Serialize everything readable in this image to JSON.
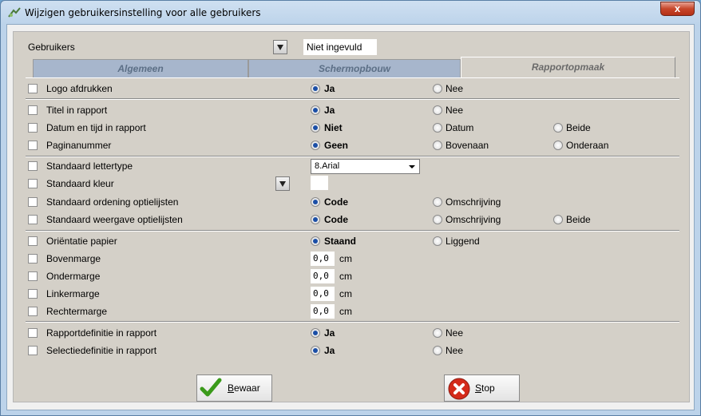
{
  "window": {
    "title": "Wijzigen gebruikersinstelling voor alle gebruikers",
    "close_label": "x"
  },
  "users": {
    "label": "Gebruikers",
    "value": "Niet ingevuld"
  },
  "tabs": [
    {
      "label": "Algemeen"
    },
    {
      "label": "Schermopbouw"
    },
    {
      "label": "Rapportopmaak"
    }
  ],
  "rows": {
    "logo": {
      "label": "Logo afdrukken",
      "opt1": "Ja",
      "opt2": "Nee"
    },
    "titel": {
      "label": "Titel in rapport",
      "opt1": "Ja",
      "opt2": "Nee"
    },
    "datum": {
      "label": "Datum en tijd in rapport",
      "opt1": "Niet",
      "opt2": "Datum",
      "opt3": "Beide"
    },
    "pagina": {
      "label": "Paginanummer",
      "opt1": "Geen",
      "opt2": "Bovenaan",
      "opt3": "Onderaan"
    },
    "lettertype": {
      "label": "Standaard lettertype",
      "value": "8.Arial"
    },
    "kleur": {
      "label": "Standaard kleur"
    },
    "ordening": {
      "label": "Standaard ordening optielijsten",
      "opt1": "Code",
      "opt2": "Omschrijving"
    },
    "weergave": {
      "label": "Standaard weergave optielijsten",
      "opt1": "Code",
      "opt2": "Omschrijving",
      "opt3": "Beide"
    },
    "orientatie": {
      "label": "Oriëntatie papier",
      "opt1": "Staand",
      "opt2": "Liggend"
    },
    "boven": {
      "label": "Bovenmarge",
      "value": "0,0",
      "unit": "cm"
    },
    "onder": {
      "label": "Ondermarge",
      "value": "0,0",
      "unit": "cm"
    },
    "linker": {
      "label": "Linkermarge",
      "value": "0,0",
      "unit": "cm"
    },
    "rechter": {
      "label": "Rechtermarge",
      "value": "0,0",
      "unit": "cm"
    },
    "rapportdef": {
      "label": "Rapportdefinitie in rapport",
      "opt1": "Ja",
      "opt2": "Nee"
    },
    "selectiedef": {
      "label": "Selectiedefinitie in rapport",
      "opt1": "Ja",
      "opt2": "Nee"
    }
  },
  "buttons": {
    "save": {
      "first": "B",
      "rest": "ewaar"
    },
    "stop": {
      "first": "S",
      "rest": "top"
    }
  },
  "colors": {
    "save_icon": "#3a9a1a",
    "stop_icon": "#d42a1a",
    "radio_selected": "#1a4ea6"
  }
}
